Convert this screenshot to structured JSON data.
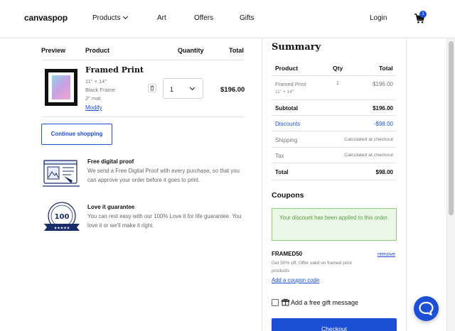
{
  "header": {
    "logo": "canvaspop",
    "nav": [
      "Products",
      "Art",
      "Offers",
      "Gifts"
    ],
    "login": "Login",
    "cart_count": "1"
  },
  "cart": {
    "columns": [
      "Preview",
      "Product",
      "Quantity",
      "Total"
    ],
    "item": {
      "name": "Framed Print",
      "size": "11\" × 14\"",
      "frame": "Black Frame",
      "mat": "2\" mat",
      "modify": "Modify",
      "quantity": "1",
      "total": "$196.00"
    },
    "continue_label": "Continue shopping"
  },
  "features": [
    {
      "icon": "digital-proof-icon",
      "title": "Free digital proof",
      "text": "We send a Free Digital Proof with every purchase, so that you can approve your order before it goes to print."
    },
    {
      "icon": "guarantee-badge-icon",
      "title": "Love it guarantee",
      "text": "You can rest easy with our 100% Love it for life guarantee. You love it or we'll make it right."
    }
  ],
  "summary": {
    "title": "Summary",
    "columns": [
      "Product",
      "Qty",
      "Total"
    ],
    "item": {
      "name": "Framed Print",
      "size": "11\" × 14\"",
      "qty": "1",
      "total": "$196.00"
    },
    "subtotal_label": "Subtotal",
    "subtotal": "$196.00",
    "discounts_label": "Discounts",
    "discounts": "-$98.00",
    "shipping_label": "Shipping",
    "shipping": "Calculated at checkout",
    "tax_label": "Tax",
    "tax": "Calculated at checkout",
    "total_label": "Total",
    "total": "$98.00"
  },
  "coupons": {
    "title": "Coupons",
    "success": "Your discount has been applied to this order.",
    "code": "FRAMED50",
    "remove": "remove",
    "description": "Get 50% off. Offer valid on framed print products",
    "add_label": "Add a coupon code"
  },
  "gift": {
    "label": "Add a free gift message",
    "checked": false
  },
  "checkout_label": "Checkout",
  "colors": {
    "accent": "#1a4fd6",
    "success_bg": "#eaf6e6",
    "success_border": "#8ed07a"
  }
}
